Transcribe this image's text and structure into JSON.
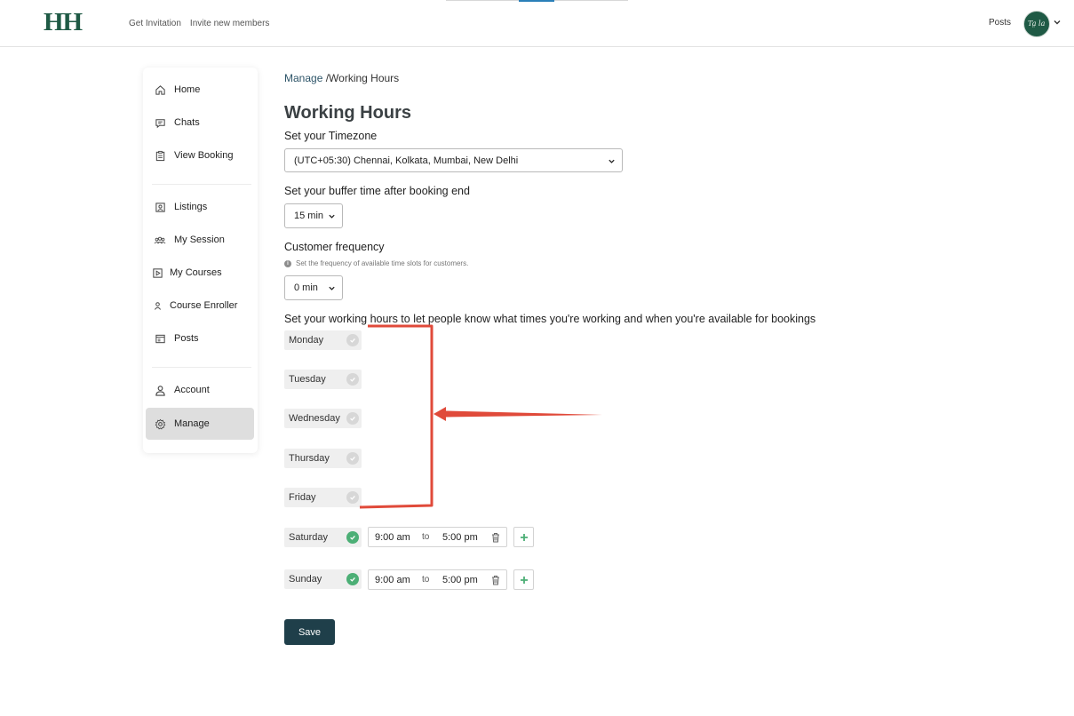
{
  "header": {
    "logo": "HH",
    "nav": [
      "Get Invitation",
      "Invite new members"
    ],
    "posts_link": "Posts",
    "avatar_signature": "Ta̤ la"
  },
  "sidebar": {
    "items": [
      {
        "label": "Home",
        "icon": "home-icon"
      },
      {
        "label": "Chats",
        "icon": "chat-icon"
      },
      {
        "label": "View Booking",
        "icon": "clipboard-icon"
      },
      {
        "label": "Listings",
        "icon": "listing-icon"
      },
      {
        "label": "My Session",
        "icon": "group-icon"
      },
      {
        "label": "My Courses",
        "icon": "play-icon"
      },
      {
        "label": "Course Enroller",
        "icon": "person-icon"
      },
      {
        "label": "Posts",
        "icon": "posts-icon"
      },
      {
        "label": "Account",
        "icon": "user-icon"
      },
      {
        "label": "Manage",
        "icon": "gear-icon"
      }
    ],
    "active": "Manage"
  },
  "breadcrumb": {
    "parent": "Manage",
    "current": " /Working Hours"
  },
  "page": {
    "title": "Working Hours",
    "timezone_label": "Set your Timezone",
    "timezone_value": "(UTC+05:30) Chennai, Kolkata, Mumbai, New Delhi",
    "buffer_label": "Set your buffer time after booking end",
    "buffer_value": "15 min",
    "frequency_label": "Customer frequency",
    "frequency_hint": "Set the frequency of available time slots for customers.",
    "frequency_hint_icon": "i",
    "frequency_value": "0 min",
    "hours_label": "Set your working hours to let people know what times you're working and when you're available for bookings",
    "days": [
      {
        "name": "Monday",
        "enabled": false
      },
      {
        "name": "Tuesday",
        "enabled": false
      },
      {
        "name": "Wednesday",
        "enabled": false
      },
      {
        "name": "Thursday",
        "enabled": false
      },
      {
        "name": "Friday",
        "enabled": false
      },
      {
        "name": "Saturday",
        "enabled": true,
        "start": "9:00 am",
        "to": "to",
        "end": "5:00 pm"
      },
      {
        "name": "Sunday",
        "enabled": true,
        "start": "9:00 am",
        "to": "to",
        "end": "5:00 pm"
      }
    ],
    "save_label": "Save"
  },
  "colors": {
    "brand": "#1f5a45",
    "save_button": "#1f3f4a",
    "check_on": "#4caf76",
    "check_off": "#d7d7d7",
    "annotation": "#e04a3a"
  }
}
